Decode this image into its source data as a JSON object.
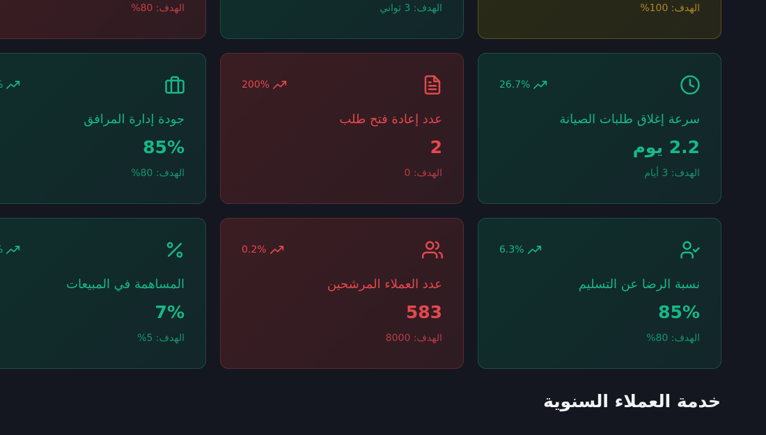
{
  "top_row": [
    {
      "target": "الهدف: 80%"
    },
    {
      "target": "الهدف: 3 ثواني"
    },
    {
      "target": "الهدف: 100%"
    }
  ],
  "row2": [
    {
      "trend": "26.7%",
      "title": "سرعة إغلاق طلبات الصيانة",
      "value": "2.2 يوم",
      "target": "الهدف: 3 أيام",
      "icon": "clock-icon"
    },
    {
      "trend": "200%",
      "title": "عدد إعادة فتح طلب",
      "value": "2",
      "target": "الهدف: 0",
      "icon": "document-icon"
    },
    {
      "trend": "%",
      "title": "جودة إدارة المرافق",
      "value": "85%",
      "target": "الهدف: 80%",
      "icon": "briefcase-icon"
    }
  ],
  "row3": [
    {
      "trend": "6.3%",
      "title": "نسبة الرضا عن التسليم",
      "value": "85%",
      "target": "الهدف: 80%",
      "icon": "user-check-icon"
    },
    {
      "trend": "0.2%",
      "title": "عدد العملاء المرشحين",
      "value": "583",
      "target": "الهدف: 8000",
      "icon": "users-icon"
    },
    {
      "trend": "%",
      "title": "المساهمة في المبيعات",
      "value": "7%",
      "target": "الهدف: 5%",
      "icon": "percent-icon"
    }
  ],
  "section": {
    "title": "خدمة العملاء السنوية"
  },
  "colors": {
    "success": "#17b886",
    "danger": "#e5484d",
    "warning": "#c9a227",
    "background": "#14171f"
  }
}
